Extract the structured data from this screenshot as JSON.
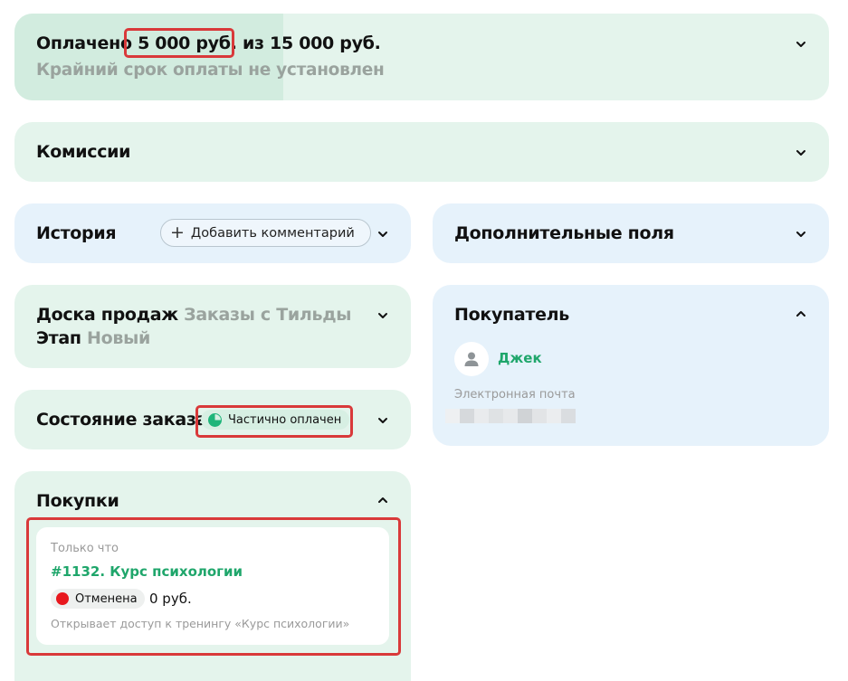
{
  "payment": {
    "prefix": "Оплачено",
    "paid_amount": "5 000 руб.",
    "suffix": "из 15 000 руб.",
    "deadline": "Крайний срок оплаты не установлен",
    "progress_percent": 33
  },
  "commissions": {
    "title": "Комиссии"
  },
  "history": {
    "title": "История",
    "add_comment_label": "Добавить комментарий"
  },
  "extra_fields": {
    "title": "Дополнительные поля"
  },
  "sales_board": {
    "board_label": "Доска продаж",
    "board_value": "Заказы с Тильды",
    "stage_label": "Этап",
    "stage_value": "Новый"
  },
  "buyer": {
    "title": "Покупатель",
    "name": "Джек",
    "email_label": "Электронная почта"
  },
  "order_state": {
    "title": "Состояние заказа",
    "status": "Частично оплачен"
  },
  "purchases": {
    "title": "Покупки",
    "items": [
      {
        "time": "Только что",
        "name": "#1132. Курс психологии",
        "status": "Отменена",
        "price": "0 руб.",
        "description": "Открывает доступ к тренингу «Курс психологии»"
      }
    ]
  },
  "colors": {
    "green_card": "#e4f4ec",
    "blue_card": "#e6f2fb",
    "accent": "#1fa66b",
    "highlight_red": "#d9393a"
  }
}
